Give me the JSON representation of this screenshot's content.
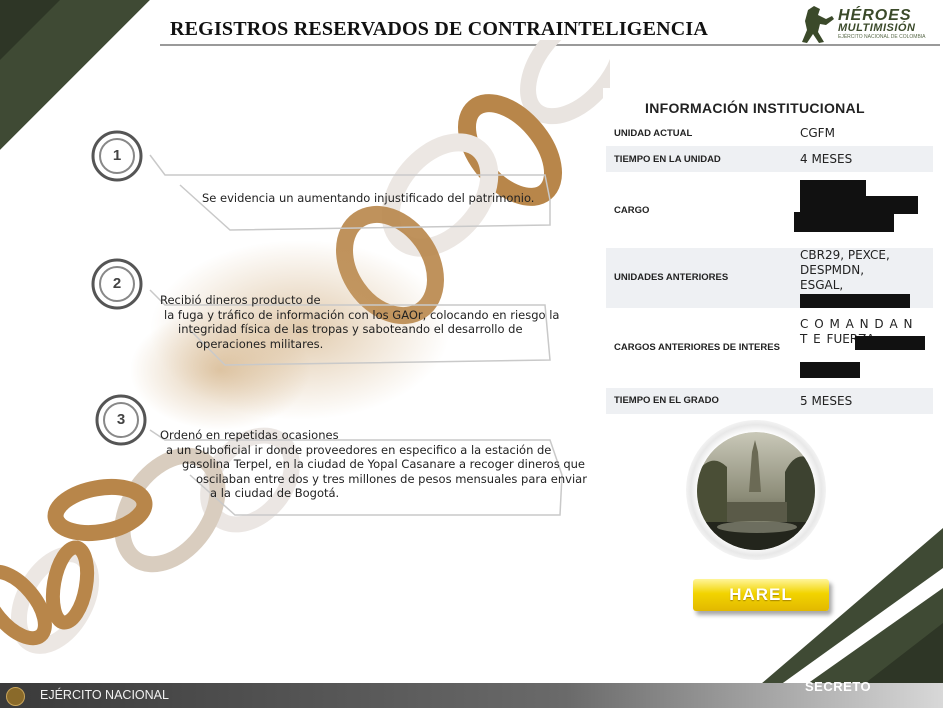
{
  "header": {
    "title": "REGISTROS RESERVADOS DE CONTRAINTELIGENCIA",
    "logo_line1": "HÉROES",
    "logo_line2": "MULTIMISIÓN",
    "logo_line3": "EJÉRCITO NACIONAL DE COLOMBIA"
  },
  "items": [
    {
      "number": "1",
      "lines": [
        "Se evidencia un aumentando injustificado del patrimonio."
      ]
    },
    {
      "number": "2",
      "lines": [
        "Recibió dineros producto de",
        "la fuga y tráfico de información  con los GAOr, colocando en riesgo la",
        "integridad física de las tropas y saboteando el desarrollo de",
        "operaciones militares."
      ]
    },
    {
      "number": "3",
      "lines": [
        "Ordenó en repetidas ocasiones",
        "a un Suboficial ir donde proveedores en especifico a la estación de",
        "gasolina Terpel, en la ciudad de Yopal Casanare a recoger dineros que",
        "oscilaban entre dos y tres millones de pesos mensuales para enviar",
        "a la ciudad de Bogotá."
      ]
    }
  ],
  "info": {
    "heading": "INFORMACIÓN INSTITUCIONAL",
    "rows": [
      {
        "label": "UNIDAD ACTUAL",
        "value": "CGFM"
      },
      {
        "label": "TIEMPO EN LA UNIDAD",
        "value": "4 MESES"
      },
      {
        "label": "CARGO",
        "value": ""
      },
      {
        "label": "UNIDADES ANTERIORES",
        "value": "CBR29, PEXCE, DESPMDN, ESGAL,"
      },
      {
        "label": "CARGOS ANTERIORES DE INTERES",
        "value": "C O M A N D A N T E  FUERZA"
      },
      {
        "label": "TIEMPO EN EL GRADO",
        "value": "5 MESES"
      }
    ]
  },
  "profile": {
    "name": "HAREL"
  },
  "footer": {
    "org": "EJÉRCITO NACIONAL",
    "classification": "SECRETO"
  },
  "colors": {
    "olive": "#3f4a34",
    "gold": "#f2d400",
    "rust": "#b8864a"
  }
}
